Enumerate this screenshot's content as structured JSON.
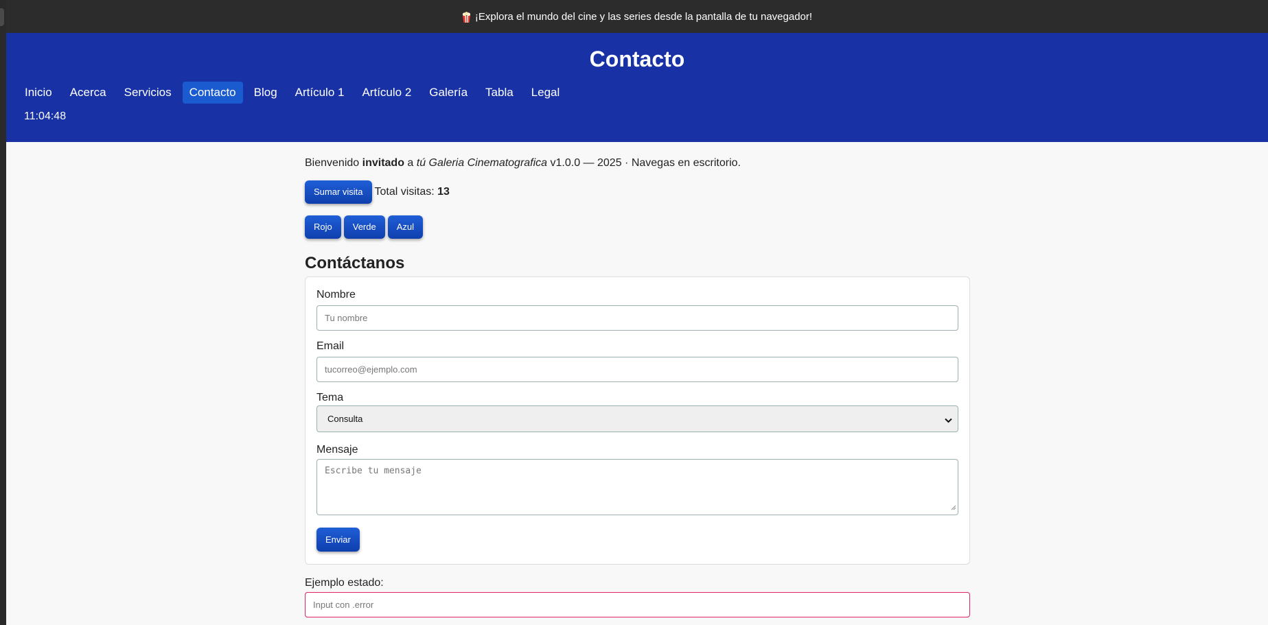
{
  "announcement": {
    "icon": "popcorn-icon",
    "text": "¡Explora el mundo del cine y las series desde la pantalla de tu navegador!"
  },
  "header": {
    "title": "Contacto",
    "background": "#1832a6",
    "nav": [
      {
        "label": "Inicio",
        "active": false
      },
      {
        "label": "Acerca",
        "active": false
      },
      {
        "label": "Servicios",
        "active": false
      },
      {
        "label": "Contacto",
        "active": true
      },
      {
        "label": "Blog",
        "active": false
      },
      {
        "label": "Artículo 1",
        "active": false
      },
      {
        "label": "Artículo 2",
        "active": false
      },
      {
        "label": "Galería",
        "active": false
      },
      {
        "label": "Tabla",
        "active": false
      },
      {
        "label": "Legal",
        "active": false
      }
    ],
    "clock": "11:04:48"
  },
  "welcome": {
    "prefix": "Bienvenido ",
    "user": "invitado",
    "middle": " a ",
    "site": "tú Galeria Cinematografica",
    "suffix": " v1.0.0 — 2025 · Navegas en escritorio."
  },
  "visits": {
    "button_label": "Sumar visita",
    "label": "Total visitas: ",
    "count": "13"
  },
  "color_buttons": {
    "red": "Rojo",
    "green": "Verde",
    "blue": "Azul"
  },
  "contact": {
    "title": "Contáctanos",
    "name_label": "Nombre",
    "name_placeholder": "Tu nombre",
    "email_label": "Email",
    "email_placeholder": "tucorreo@ejemplo.com",
    "topic_label": "Tema",
    "topic_value": "Consulta",
    "message_label": "Mensaje",
    "message_placeholder": "Escribe tu mensaje",
    "submit_label": "Enviar"
  },
  "status_example": {
    "label": "Ejemplo estado:",
    "placeholder": "Input con .error",
    "error_color": "#e0245e"
  },
  "accent_color": "#1f5ed6"
}
